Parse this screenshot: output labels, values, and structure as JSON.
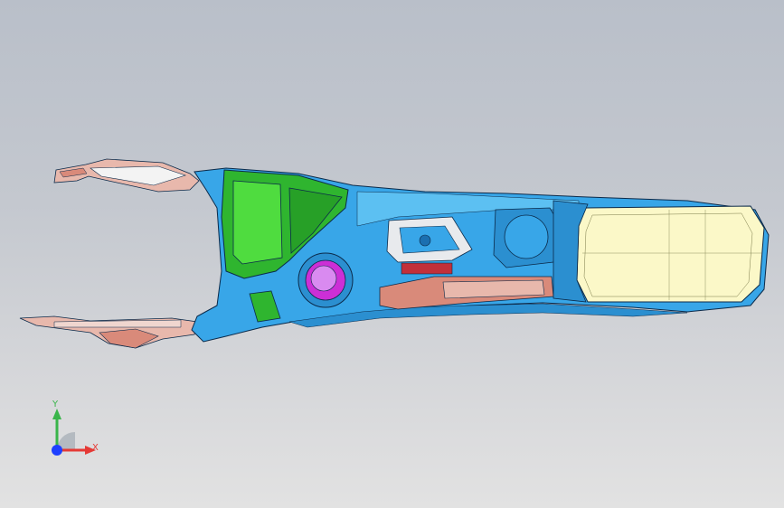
{
  "viewport": {
    "background_top": "#b9bfc9",
    "background_bottom": "#e2e2e2"
  },
  "model": {
    "colors": {
      "body_blue": "#38a6e8",
      "body_blue_dark": "#1b6fb0",
      "green_panel": "#2fb52f",
      "green_light": "#4fdc3f",
      "armrest": "#fbf8c8",
      "armrest_outline": "#7a7a4a",
      "salmon": "#d98a7a",
      "magenta": "#cc2fd6",
      "red_strip": "#c2303a",
      "edges": "#0b2a4a"
    }
  },
  "triad": {
    "y_label": "Y",
    "x_label": "X",
    "y_color": "#39b54a",
    "x_color": "#e53935",
    "z_color": "#1e40ff"
  }
}
